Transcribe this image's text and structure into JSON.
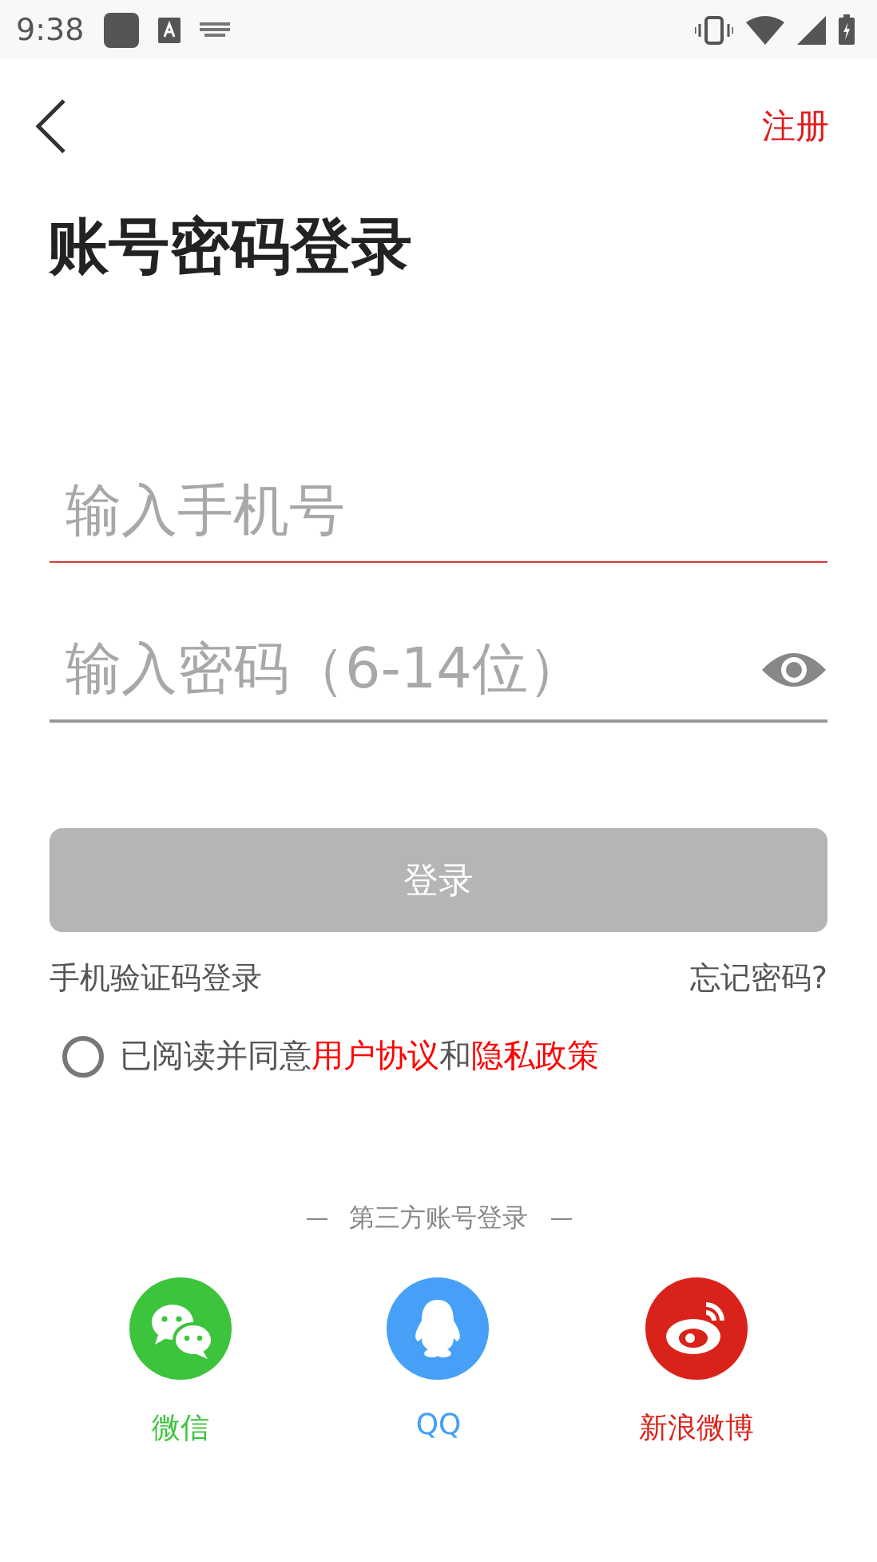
{
  "status_bar": {
    "time": "9:38"
  },
  "header": {
    "action": "注册"
  },
  "title": "账号密码登录",
  "fields": [
    {
      "kind": "phone",
      "placeholder": "输入手机号",
      "focused": true
    },
    {
      "kind": "password",
      "placeholder": "输入密码（6-14位）",
      "focused": false
    }
  ],
  "login_button": {
    "label": "登录",
    "disabled": true
  },
  "links": [
    "手机验证码登录",
    "忘记密码?"
  ],
  "agreement": {
    "checked": false,
    "parts": [
      {
        "kind": "text",
        "text": "已阅读并同意"
      },
      {
        "kind": "link",
        "text": "用户协议"
      },
      {
        "kind": "text",
        "text": "和"
      },
      {
        "kind": "link",
        "text": "隐私政策"
      }
    ]
  },
  "third_party": {
    "heading": "第三方账号登录",
    "providers": [
      {
        "kind": "wechat",
        "label": "微信",
        "color": "#3cc43c"
      },
      {
        "kind": "qq",
        "label": "QQ",
        "color": "#46a0f7"
      },
      {
        "kind": "weibo",
        "label": "新浪微博",
        "color": "#d9231a"
      }
    ]
  }
}
